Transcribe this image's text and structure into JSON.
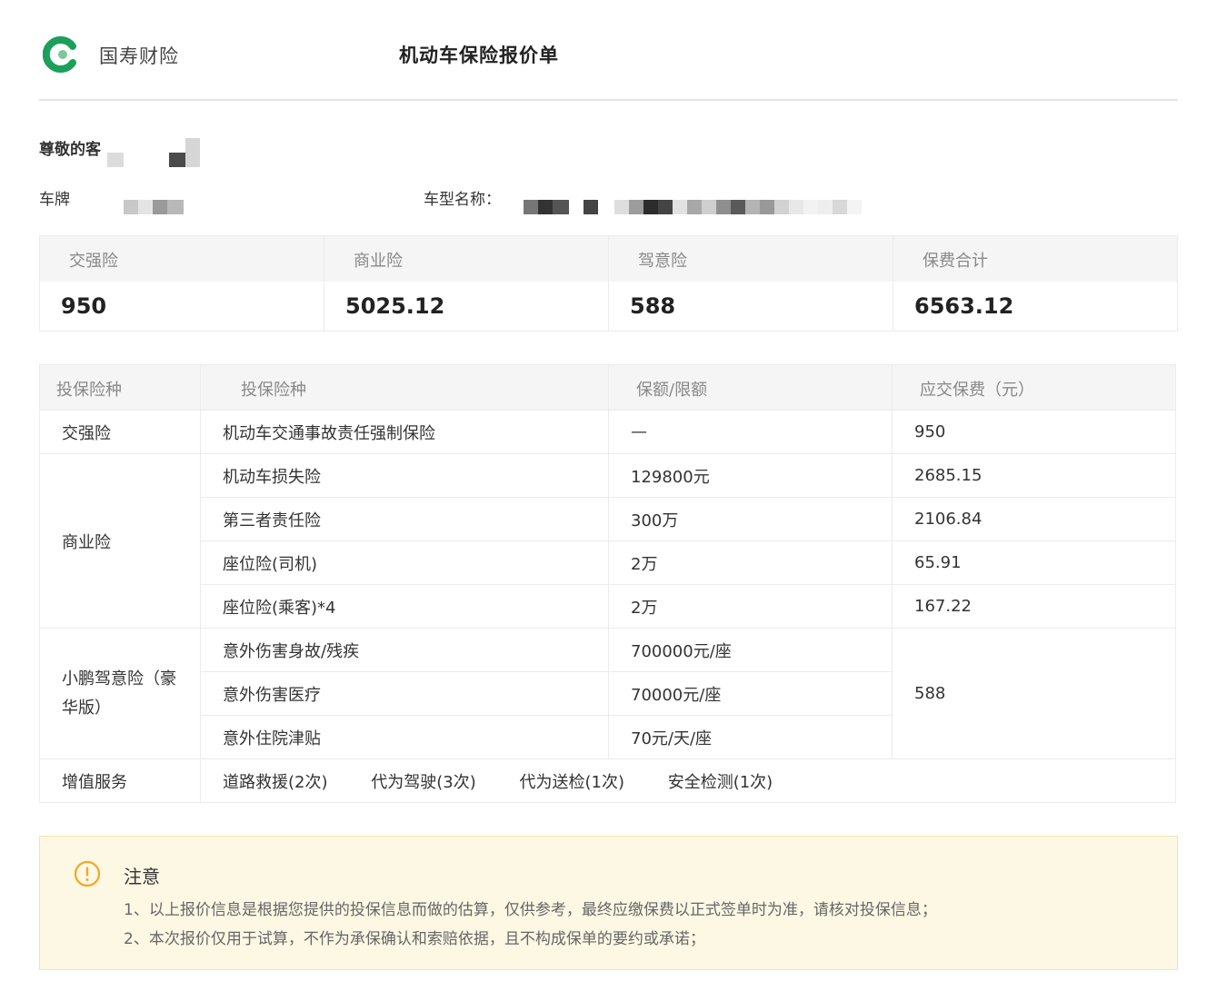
{
  "header": {
    "brand": "国寿财险",
    "title": "机动车保险报价单"
  },
  "customer": {
    "greeting": "尊敬的客",
    "plate_label": "车牌",
    "model_label": "车型名称："
  },
  "summary": [
    {
      "label": "交强险",
      "value": "950"
    },
    {
      "label": "商业险",
      "value": "5025.12"
    },
    {
      "label": "驾意险",
      "value": "588"
    },
    {
      "label": "保费合计",
      "value": "6563.12"
    }
  ],
  "detail": {
    "headers": [
      "投保险种",
      "投保险种",
      "保额/限额",
      "应交保费（元）"
    ],
    "jqx": {
      "category": "交强险",
      "item": "机动车交通事故责任强制保险",
      "amount": "—",
      "premium": "950"
    },
    "syx": {
      "category": "商业险",
      "rows": [
        {
          "item": "机动车损失险",
          "amount": "129800元",
          "premium": "2685.15"
        },
        {
          "item": "第三者责任险",
          "amount": "300万",
          "premium": "2106.84"
        },
        {
          "item": "座位险(司机)",
          "amount": "2万",
          "premium": "65.91"
        },
        {
          "item": "座位险(乘客)*4",
          "amount": "2万",
          "premium": "167.22"
        }
      ]
    },
    "jyx": {
      "category": "小鹏驾意险（豪华版）",
      "premium": "588",
      "rows": [
        {
          "item": "意外伤害身故/残疾",
          "amount": "700000元/座"
        },
        {
          "item": "意外伤害医疗",
          "amount": "70000元/座"
        },
        {
          "item": "意外住院津贴",
          "amount": "70元/天/座"
        }
      ]
    },
    "services": {
      "category": "增值服务",
      "items": [
        "道路救援(2次)",
        "代为驾驶(3次)",
        "代为送检(1次)",
        "安全检测(1次)"
      ]
    }
  },
  "notice": {
    "title": "注意",
    "lines": [
      "1、以上报价信息是根据您提供的投保信息而做的估算，仅供参考，最终应缴保费以正式签单时为准，请核对投保信息；",
      "2、本次报价仅用于试算，不作为承保确认和索赔依据，且不构成保单的要约或承诺；"
    ]
  },
  "colors": {
    "brand_green": "#1aa05a",
    "notice_bg": "#fdf8e4",
    "warn_orange": "#f5a623",
    "header_bg": "#f5f5f5"
  },
  "icons": {
    "logo": "brand-logo-icon",
    "warning": "warning-circle-icon"
  }
}
